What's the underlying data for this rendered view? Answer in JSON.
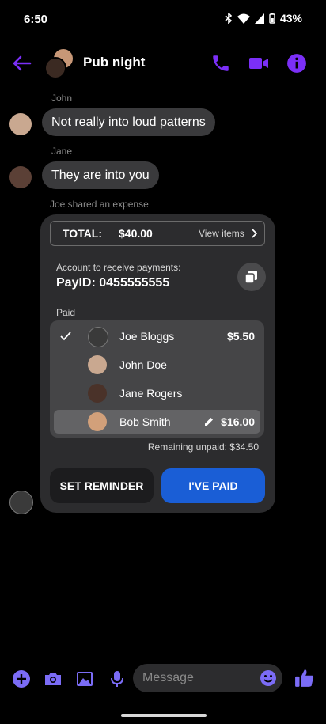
{
  "status_bar": {
    "time": "6:50",
    "battery": "43%"
  },
  "header": {
    "title": "Pub night"
  },
  "messages": [
    {
      "sender": "John",
      "text": "Not really into loud patterns"
    },
    {
      "sender": "Jane",
      "text": "They are into you"
    }
  ],
  "expense": {
    "shared_note": "Joe shared an expense",
    "total_label": "TOTAL:",
    "total_amount": "$40.00",
    "view_items": "View items",
    "account_label": "Account to receive payments:",
    "payid": "PayID: 0455555555",
    "paid_label": "Paid",
    "people": [
      {
        "name": "Joe Bloggs",
        "amount": "$5.50",
        "checked": true
      },
      {
        "name": "John Doe",
        "amount": ""
      },
      {
        "name": "Jane Rogers",
        "amount": ""
      },
      {
        "name": "Bob Smith",
        "amount": "$16.00",
        "editable": true
      }
    ],
    "remaining": "Remaining unpaid: $34.50",
    "set_reminder": "SET REMINDER",
    "ive_paid": "I'VE PAID"
  },
  "composer": {
    "placeholder": "Message"
  },
  "colors": {
    "accent": "#7b2ff7",
    "primary_button": "#1a5ed6",
    "bubble": "#3a3a3c",
    "card": "#2c2c2e"
  },
  "icons": [
    "back-arrow-icon",
    "phone-icon",
    "video-icon",
    "info-icon",
    "copy-icon",
    "check-icon",
    "pencil-icon",
    "chevron-right-icon",
    "plus-icon",
    "camera-icon",
    "image-icon",
    "mic-icon",
    "emoji-icon",
    "thumbs-up-icon"
  ]
}
